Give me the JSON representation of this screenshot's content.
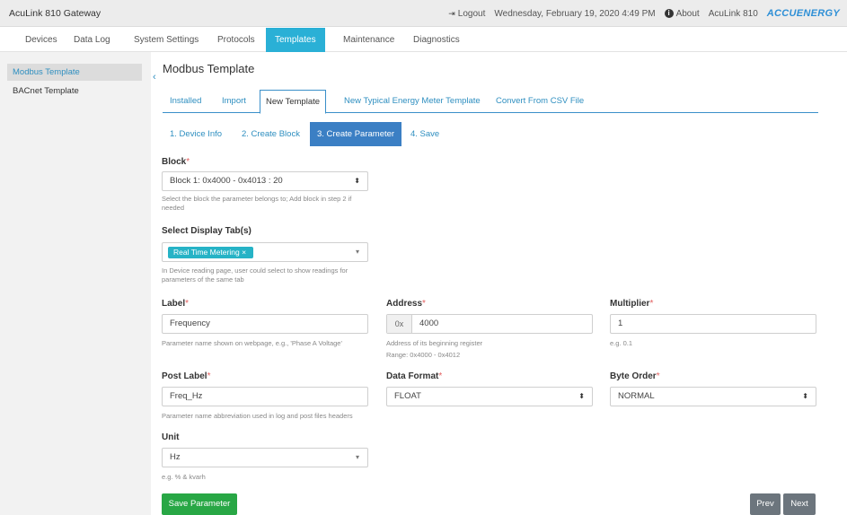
{
  "app": {
    "title": "AcuLink 810 Gateway"
  },
  "topbar": {
    "logout_icon": "logout-icon",
    "logout_label": "Logout",
    "datetime": "Wednesday, February 19, 2020 4:49 PM",
    "about_label": "About",
    "device_label": "AcuLink 810",
    "brand": "ACCUENERGY"
  },
  "nav": {
    "items": [
      "Devices",
      "Data Log",
      "System Settings",
      "Protocols",
      "Templates",
      "Maintenance",
      "Diagnostics"
    ],
    "active": "Templates"
  },
  "sidebar": {
    "items": [
      "Modbus Template",
      "BACnet Template"
    ],
    "active": "Modbus Template"
  },
  "page": {
    "title": "Modbus Template"
  },
  "tabs": {
    "items": [
      "Installed",
      "Import",
      "New Template",
      "New Typical Energy Meter Template",
      "Convert From CSV File"
    ],
    "active": "New Template"
  },
  "steps": {
    "items": [
      "1. Device Info",
      "2. Create Block",
      "3. Create Parameter",
      "4. Save"
    ],
    "active": "3. Create Parameter"
  },
  "form": {
    "required_mark": "*",
    "block": {
      "label": "Block",
      "value": "Block 1: 0x4000 - 0x4013 : 20",
      "help": "Select the block the parameter belongs to; Add block in step 2 if needed"
    },
    "display_tab": {
      "label": "Select Display Tab(s)",
      "chip": "Real Time Metering",
      "help": "In Device reading page, user could select to show readings for parameters of the same tab"
    },
    "label_field": {
      "label": "Label",
      "value": "Frequency",
      "help": "Parameter name shown on webpage, e.g., 'Phase A Voltage'"
    },
    "address": {
      "label": "Address",
      "prefix": "0x",
      "value": "4000",
      "help": "Address of its beginning register",
      "range": "Range: 0x4000 - 0x4012"
    },
    "multiplier": {
      "label": "Multiplier",
      "value": "1",
      "help": "e.g. 0.1"
    },
    "post_label": {
      "label": "Post Label",
      "value": "Freq_Hz",
      "help": "Parameter name abbreviation used in log and post files headers"
    },
    "data_format": {
      "label": "Data Format",
      "value": "FLOAT"
    },
    "byte_order": {
      "label": "Byte Order",
      "value": "NORMAL"
    },
    "unit": {
      "label": "Unit",
      "value": "Hz",
      "help": "e.g. % & kvarh"
    }
  },
  "buttons": {
    "save": "Save Parameter",
    "prev": "Prev",
    "next": "Next"
  }
}
